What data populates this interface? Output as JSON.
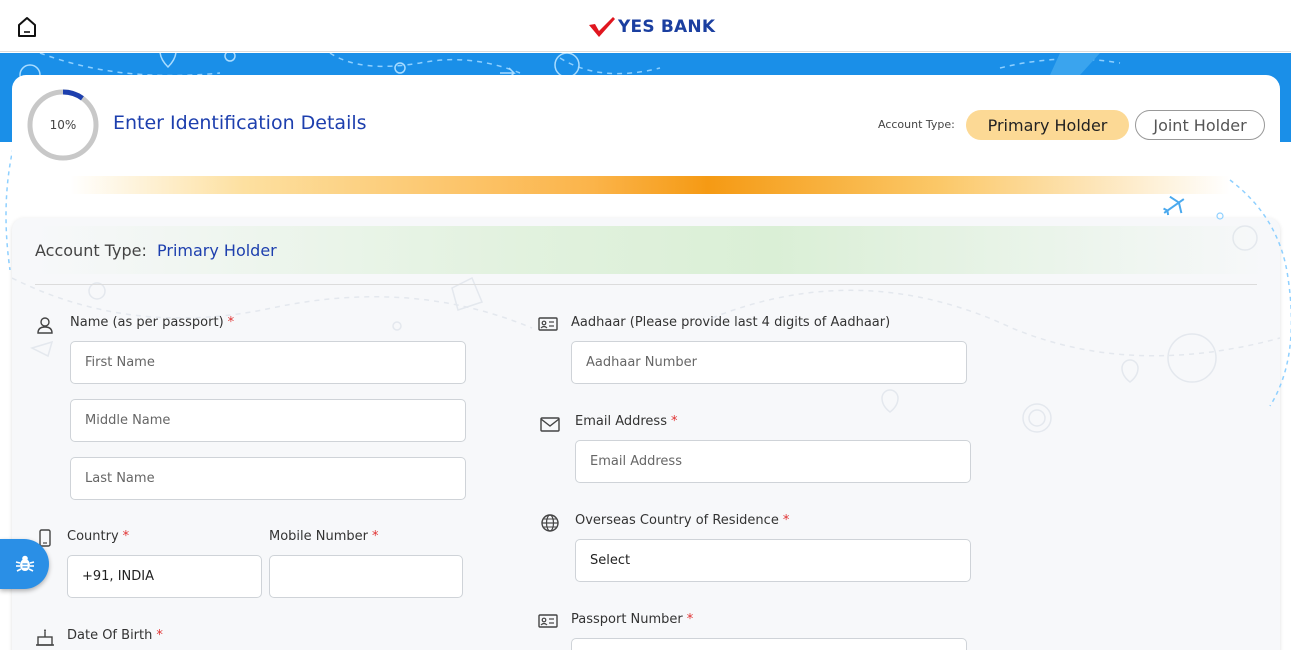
{
  "header": {
    "logo_text": "YES BANK",
    "icons": {
      "home": "home-icon",
      "logo_mark": "yes-bank-check-icon"
    }
  },
  "progress": {
    "label": "10%",
    "value": 0.1
  },
  "page_title": "Enter Identification Details",
  "account_type_selector": {
    "label": "Account Type:",
    "options": [
      "Primary Holder",
      "Joint Holder"
    ],
    "selected": "Primary Holder"
  },
  "form": {
    "account_type_label": "Account Type:",
    "account_type_value": "Primary Holder",
    "name": {
      "label": "Name (as per passport)",
      "required_mark": "*",
      "first_placeholder": "First Name",
      "middle_placeholder": "Middle Name",
      "last_placeholder": "Last Name"
    },
    "country": {
      "label": "Country",
      "required_mark": "*",
      "value": "+91, INDIA"
    },
    "mobile": {
      "label": "Mobile Number",
      "required_mark": "*",
      "value": ""
    },
    "dob": {
      "label": "Date Of Birth",
      "required_mark": "*"
    },
    "aadhaar": {
      "label": "Aadhaar (Please provide last 4 digits of Aadhaar)",
      "placeholder": "Aadhaar Number"
    },
    "email": {
      "label": "Email Address",
      "required_mark": "*",
      "placeholder": "Email Address"
    },
    "overseas_country": {
      "label": "Overseas Country of Residence",
      "required_mark": "*",
      "value": "Select"
    },
    "passport": {
      "label": "Passport Number",
      "required_mark": "*"
    }
  },
  "colors": {
    "brand_blue": "#1d3fae",
    "band_blue": "#1a8fe8",
    "selected_pill": "#fcd995",
    "required": "#e03030",
    "accent_orange": "#f59a14"
  }
}
